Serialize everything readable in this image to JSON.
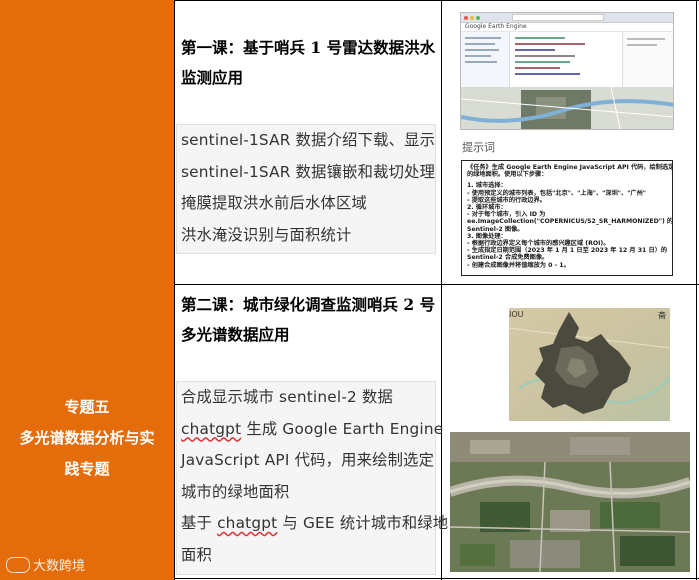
{
  "topic": {
    "line1": "专题五",
    "line2": "多光谱数据分析与实",
    "line3": "践专题"
  },
  "lesson1": {
    "title_line1": "第一课：基于哨兵 1 号雷达数据洪水",
    "title_line2": "监测应用",
    "items": [
      "sentinel-1SAR 数据介绍下载、显示",
      "sentinel-1SAR 数据镶嵌和裁切处理",
      "掩膜提取洪水前后水体区域",
      "洪水淹没识别与面积统计"
    ]
  },
  "lesson2": {
    "title_line1": "第二课：城市绿化调查监测哨兵 2 号",
    "title_line2": "多光谱数据应用",
    "items": [
      {
        "pre": "合成显示城市 sentinel-2 数据",
        "wavy": "",
        "post": ""
      },
      {
        "pre": "",
        "wavy": "chatgpt",
        "post": " 生成 Google Earth Engine"
      },
      {
        "pre": "JavaScript API 代码，用来绘制选定",
        "wavy": "",
        "post": ""
      },
      {
        "pre": "城市的绿地面积",
        "wavy": "",
        "post": ""
      },
      {
        "pre": "基于 ",
        "wavy": "chatgpt",
        "post": " 与 GEE 统计城市和绿地"
      },
      {
        "pre": "面积",
        "wavy": "",
        "post": ""
      }
    ]
  },
  "screenshot": {
    "window_title": "Google Earth Engine",
    "prompt_label": "提示词"
  },
  "prompt_card": {
    "lines": [
      "《任务》生成 Google Earth Engine JavaScript API 代码，绘制选定城市",
      "的绿地面积。使用以下步骤：",
      "",
      "1. 城市选择：",
      "  - 使用预定义的城市列表，包括\"北京\"、\"上海\"、\"深圳\"、\"广州\"",
      "  - 提取这些城市的行政边界。",
      "2. 循环城市：",
      "  - 对于每个城市，引入 ID 为",
      "ee.ImageCollection(\"COPERNICUS/S2_SR_HARMONIZED\") 的",
      "Sentinel-2 图像。",
      "3. 图像处理：",
      "  - 根据行政边界定义每个城市的感兴趣区域 (ROI)。",
      "  - 生成指定日期范围（2023 年 1 月 1 日至 2023 年 12 月 31 日）的",
      "Sentinel-2 合成免费图像。",
      "  - 创建合成图像并将值缩放为 0 - 1。"
    ]
  },
  "map_labels": {
    "north_label": "IOU",
    "corner_label": "斋"
  },
  "watermark": "大数跨境",
  "colors": {
    "orange": "#E46C0A",
    "border": "#000000"
  }
}
